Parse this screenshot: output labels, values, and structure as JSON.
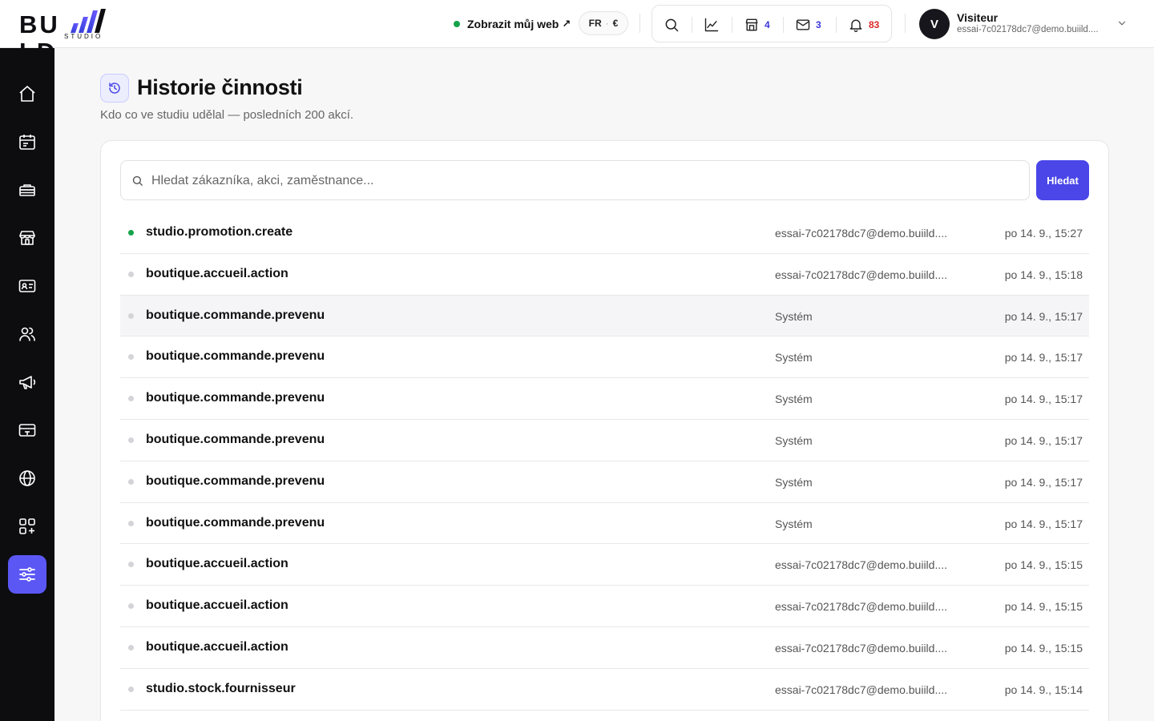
{
  "brand": {
    "logo_text": "BU LD",
    "logo_sub": "STUDIO"
  },
  "header": {
    "view_site_label": "Zobrazit můj web",
    "view_site_arrow": "↗",
    "lang": "FR",
    "currency": "€",
    "counts": {
      "shop": "4",
      "mail": "3",
      "notifications": "83"
    },
    "colors": {
      "shop": "#3b37d9",
      "mail": "#3b37d9",
      "notifications": "#dc2626"
    }
  },
  "user": {
    "avatar_letter": "V",
    "name": "Visiteur",
    "email": "essai-7c02178dc7@demo.buiild...."
  },
  "sidebar": {
    "items": [
      {
        "icon": "home-icon"
      },
      {
        "icon": "calendar-icon"
      },
      {
        "icon": "orders-icon"
      },
      {
        "icon": "store-icon"
      },
      {
        "icon": "contact-card-icon"
      },
      {
        "icon": "users-icon"
      },
      {
        "icon": "megaphone-icon"
      },
      {
        "icon": "payment-card-icon"
      },
      {
        "icon": "globe-icon"
      },
      {
        "icon": "apps-icon"
      },
      {
        "icon": "settings-sliders-icon",
        "active": true
      }
    ]
  },
  "page": {
    "title": "Historie činnosti",
    "subtitle": "Kdo co ve studiu udělal — posledních 200 akcí."
  },
  "search": {
    "placeholder": "Hledat zákazníka, akci, zaměstnance...",
    "value": "",
    "button_label": "Hledat"
  },
  "activity": {
    "rows": [
      {
        "action": "studio.promotion.create",
        "actor": "essai-7c02178dc7@demo.buiild....",
        "time": "po 14. 9., 15:27",
        "live": true
      },
      {
        "action": "boutique.accueil.action",
        "actor": "essai-7c02178dc7@demo.buiild....",
        "time": "po 14. 9., 15:18"
      },
      {
        "action": "boutique.commande.prevenu",
        "actor": "Systém",
        "time": "po 14. 9., 15:17"
      },
      {
        "action": "boutique.commande.prevenu",
        "actor": "Systém",
        "time": "po 14. 9., 15:17"
      },
      {
        "action": "boutique.commande.prevenu",
        "actor": "Systém",
        "time": "po 14. 9., 15:17"
      },
      {
        "action": "boutique.commande.prevenu",
        "actor": "Systém",
        "time": "po 14. 9., 15:17"
      },
      {
        "action": "boutique.commande.prevenu",
        "actor": "Systém",
        "time": "po 14. 9., 15:17"
      },
      {
        "action": "boutique.commande.prevenu",
        "actor": "Systém",
        "time": "po 14. 9., 15:17"
      },
      {
        "action": "boutique.accueil.action",
        "actor": "essai-7c02178dc7@demo.buiild....",
        "time": "po 14. 9., 15:15"
      },
      {
        "action": "boutique.accueil.action",
        "actor": "essai-7c02178dc7@demo.buiild....",
        "time": "po 14. 9., 15:15"
      },
      {
        "action": "boutique.accueil.action",
        "actor": "essai-7c02178dc7@demo.buiild....",
        "time": "po 14. 9., 15:15"
      },
      {
        "action": "studio.stock.fournisseur",
        "actor": "essai-7c02178dc7@demo.buiild....",
        "time": "po 14. 9., 15:14"
      }
    ]
  }
}
